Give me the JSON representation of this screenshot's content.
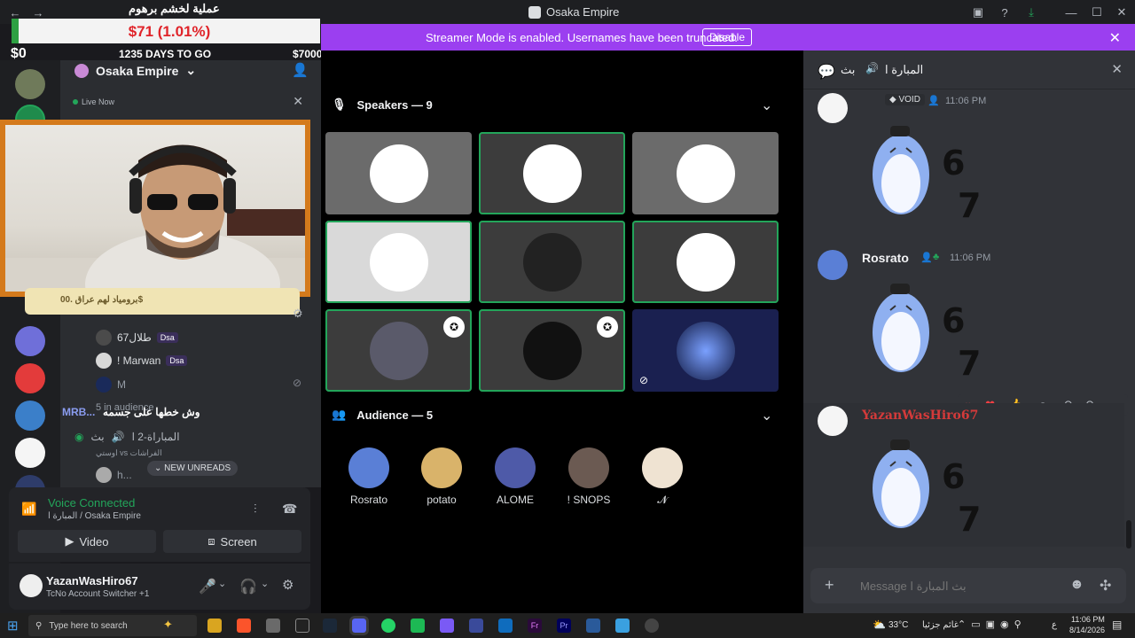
{
  "window": {
    "title": "Osaka Empire"
  },
  "banner": {
    "message": "Streamer Mode is enabled. Usernames have been truncated.",
    "disable_label": "Disable"
  },
  "overlay": {
    "arabic_title": "عملية لخشم برهوم",
    "raised": "$71 (1.01%)",
    "start": "$0",
    "days": "1235 DAYS TO GO",
    "goal": "$7000",
    "name_strip": "برومياد لهم عراق .00$"
  },
  "sidebar": {
    "server_name": "Osaka Empire",
    "live_now": "Live Now",
    "members": [
      {
        "name": "طلال67",
        "badge": "Dsa"
      },
      {
        "name": "! Marwan",
        "badge": "Dsa"
      },
      {
        "name": "M",
        "badge": ""
      }
    ],
    "in_audience": "5 in audience",
    "arabic_line": "وش خطها على جسمه",
    "mrb_label": "MRB...",
    "channel": "المباراة-2 ا",
    "channel_prefix": "بث",
    "topic": "اوستي vs الفراشات",
    "new_unreads": "NEW UNREADS",
    "partial_user": "h..."
  },
  "voice": {
    "status": "Voice Connected",
    "channel": "المبارة ا / Osaka Empire",
    "video_label": "Video",
    "screen_label": "Screen"
  },
  "user": {
    "name": "YazanWasHiro67",
    "status": "TcNo Account Switcher +1"
  },
  "stage": {
    "speakers_label": "Speakers — 9",
    "audience_label": "Audience — 5",
    "audience": [
      {
        "name": "Rosrato",
        "color": "#5a7fd6"
      },
      {
        "name": "potato",
        "color": "#d9b36a"
      },
      {
        "name": "ALOME",
        "color": "#4e5aa8"
      },
      {
        "name": "! SNOPS",
        "color": "#6b5a52"
      },
      {
        "name": "𝓝",
        "color": "#efe3d2"
      }
    ]
  },
  "chat": {
    "header": "المبارة ا",
    "header_prefix": "بث",
    "void_badge": "VOID",
    "messages": [
      {
        "author": "",
        "time": "11:06 PM"
      },
      {
        "author": "Rosrato",
        "time": "11:06 PM"
      },
      {
        "author": "YazanWasHiro67",
        "time": "11:06 PM"
      }
    ],
    "sticker_text_6": "6",
    "sticker_text_7": "7",
    "input_placeholder": "Message بث المبارة ا"
  },
  "taskbar": {
    "search_placeholder": "Type here to search",
    "weather": "33°C",
    "weather_desc": "غائم جزئيا",
    "time": "11:06 PM",
    "date": "8/14/2026",
    "lang": "ع"
  }
}
